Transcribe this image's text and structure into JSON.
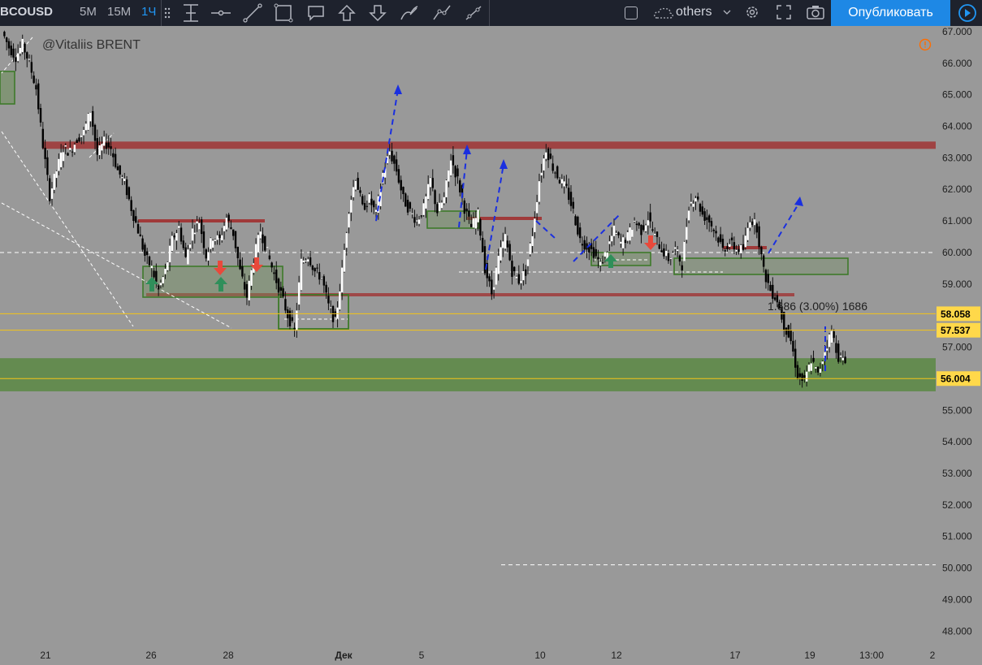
{
  "toolbar": {
    "symbol": "BCOUSD",
    "intervals": [
      "5M",
      "15M",
      "1Ч"
    ],
    "active_interval": "1Ч",
    "others_label": "others",
    "publish_label": "Опубликовать"
  },
  "watermark": "@Vitaliis BRENT",
  "chart_data": {
    "type": "line",
    "title": "",
    "price_axis_ticks": [
      "48.000",
      "49.000",
      "50.000",
      "51.000",
      "52.000",
      "53.000",
      "54.000",
      "55.000",
      "56.000",
      "57.000",
      "58.000",
      "59.000",
      "60.000",
      "61.000",
      "62.000",
      "63.000",
      "64.000",
      "65.000",
      "66.000",
      "67.000"
    ],
    "ylim": [
      47.75,
      67.05
    ],
    "time_axis_ticks": [
      "21",
      "26",
      "28",
      "Дек",
      "5",
      "10",
      "12",
      "17",
      "19",
      "13:00",
      "2"
    ],
    "price_labels": [
      {
        "value": 58.058,
        "text": "58.058"
      },
      {
        "value": 57.537,
        "text": "57.537"
      },
      {
        "value": 56.004,
        "text": "56.004"
      }
    ],
    "measure_label": "1.686 (3.00%) 1686",
    "resistance_level": 63.4,
    "support_zone": [
      55.6,
      56.65
    ],
    "dashed_levels": [
      60.0,
      50.1
    ],
    "series": [
      {
        "values": [
          67.0,
          66.5,
          66.2,
          66.6,
          66.0,
          65.2,
          63.4,
          61.8,
          62.6,
          63.3,
          63.2,
          63.6,
          63.8,
          64.5,
          63.1,
          63.5,
          63.3,
          62.6,
          62.2,
          61.4,
          60.7,
          59.9,
          59.5,
          58.8,
          59.4,
          60.4,
          60.8,
          59.8,
          60.7,
          61.0,
          59.9,
          60.5,
          60.4,
          61.1,
          60.6,
          59.4,
          58.6,
          59.8,
          60.7,
          60.0,
          59.3,
          58.7,
          58.0,
          57.5,
          59.7,
          59.9,
          59.4,
          59.2,
          58.3,
          57.8,
          59.4,
          61.4,
          62.4,
          61.4,
          61.7,
          61.2,
          62.5,
          63.2,
          62.6,
          61.7,
          61.3,
          61.0,
          61.4,
          62.3,
          61.3,
          61.7,
          63.0,
          62.3,
          61.4,
          60.8,
          61.2,
          59.5,
          58.7,
          59.8,
          60.5,
          59.4,
          59.1,
          59.4,
          60.6,
          62.3,
          63.3,
          62.7,
          62.3,
          62.0,
          61.3,
          60.4,
          60.2,
          60.0,
          59.6,
          60.1,
          60.7,
          60.3,
          60.5,
          61.0,
          60.7,
          61.1,
          60.5,
          60.1,
          59.8,
          60.1,
          59.6,
          61.5,
          61.8,
          61.2,
          61.0,
          60.6,
          60.1,
          60.3,
          60.1,
          60.1,
          61.1,
          60.8,
          59.4,
          58.8,
          58.5,
          57.7,
          57.2,
          56.1,
          55.9,
          56.6,
          56.1,
          56.9,
          57.5,
          56.7,
          56.5
        ]
      }
    ]
  }
}
